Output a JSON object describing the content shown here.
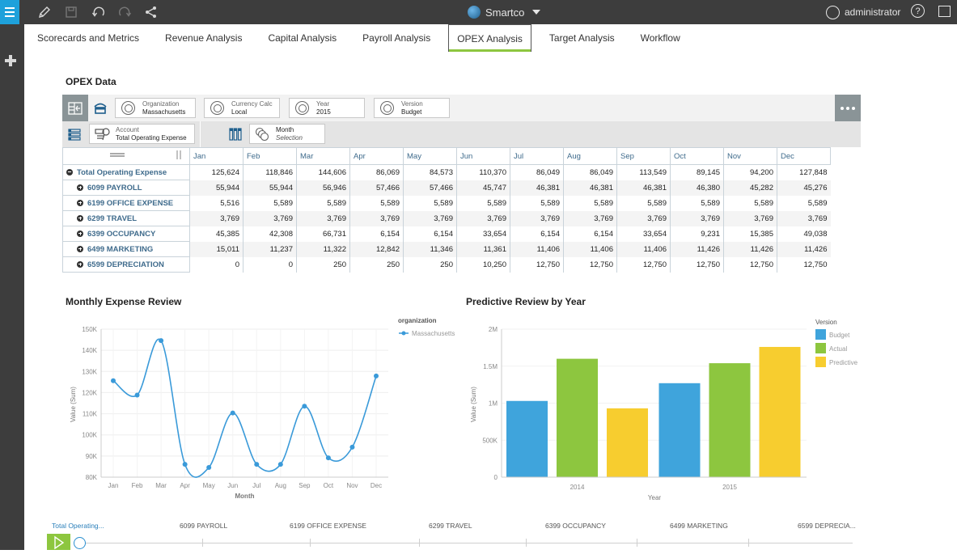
{
  "topbar": {
    "brand": "Smartco",
    "user": "administrator",
    "icons": [
      "menu-icon",
      "pencil-icon",
      "save-icon",
      "undo-icon",
      "redo-icon",
      "share-icon",
      "help-icon",
      "fullscreen-icon"
    ]
  },
  "sidebar": {
    "add_icon": "plus-icon"
  },
  "tabs": [
    {
      "label": "Scorecards and Metrics",
      "active": false
    },
    {
      "label": "Revenue Analysis",
      "active": false
    },
    {
      "label": "Capital Analysis",
      "active": false
    },
    {
      "label": "Payroll Analysis",
      "active": false
    },
    {
      "label": "OPEX Analysis",
      "active": true
    },
    {
      "label": "Target Analysis",
      "active": false
    },
    {
      "label": "Workflow",
      "active": false
    }
  ],
  "opex": {
    "title": "OPEX Data",
    "filters": [
      {
        "key": "Organization",
        "value": "Massachusetts"
      },
      {
        "key": "Currency Calc",
        "value": "Local"
      },
      {
        "key": "Year",
        "value": "2015"
      },
      {
        "key": "Version",
        "value": "Budget"
      }
    ],
    "rows_dimension": {
      "key": "Account",
      "value": "Total Operating Expense"
    },
    "columns_dimension": {
      "key": "Month",
      "value": "Selection"
    },
    "months": [
      "Jan",
      "Feb",
      "Mar",
      "Apr",
      "May",
      "Jun",
      "Jul",
      "Aug",
      "Sep",
      "Oct",
      "Nov",
      "Dec"
    ],
    "rows": [
      {
        "label": "Total Operating Expense",
        "expanded": true,
        "values": [
          "125,624",
          "118,846",
          "144,606",
          "86,069",
          "84,573",
          "110,370",
          "86,049",
          "86,049",
          "113,549",
          "89,145",
          "94,200",
          "127,848"
        ]
      },
      {
        "label": "6099 PAYROLL",
        "expanded": false,
        "values": [
          "55,944",
          "55,944",
          "56,946",
          "57,466",
          "57,466",
          "45,747",
          "46,381",
          "46,381",
          "46,381",
          "46,380",
          "45,282",
          "45,276"
        ]
      },
      {
        "label": "6199 OFFICE EXPENSE",
        "expanded": false,
        "values": [
          "5,516",
          "5,589",
          "5,589",
          "5,589",
          "5,589",
          "5,589",
          "5,589",
          "5,589",
          "5,589",
          "5,589",
          "5,589",
          "5,589"
        ]
      },
      {
        "label": "6299 TRAVEL",
        "expanded": false,
        "values": [
          "3,769",
          "3,769",
          "3,769",
          "3,769",
          "3,769",
          "3,769",
          "3,769",
          "3,769",
          "3,769",
          "3,769",
          "3,769",
          "3,769"
        ]
      },
      {
        "label": "6399 OCCUPANCY",
        "expanded": false,
        "values": [
          "45,385",
          "42,308",
          "66,731",
          "6,154",
          "6,154",
          "33,654",
          "6,154",
          "6,154",
          "33,654",
          "9,231",
          "15,385",
          "49,038"
        ]
      },
      {
        "label": "6499 MARKETING",
        "expanded": false,
        "values": [
          "15,011",
          "11,237",
          "11,322",
          "12,842",
          "11,346",
          "11,361",
          "11,406",
          "11,406",
          "11,406",
          "11,426",
          "11,426",
          "11,426"
        ]
      },
      {
        "label": "6599 DEPRECIATION",
        "expanded": false,
        "values": [
          "0",
          "0",
          "250",
          "250",
          "250",
          "10,250",
          "12,750",
          "12,750",
          "12,750",
          "12,750",
          "12,750",
          "12,750"
        ]
      }
    ]
  },
  "chart_data": [
    {
      "type": "line",
      "title": "Monthly Expense Review",
      "xlabel": "Month",
      "ylabel": "Value (Sum)",
      "categories": [
        "Jan",
        "Feb",
        "Mar",
        "Apr",
        "May",
        "Jun",
        "Jul",
        "Aug",
        "Sep",
        "Oct",
        "Nov",
        "Dec"
      ],
      "ylim": [
        80000,
        150000
      ],
      "yticks": [
        80000,
        90000,
        100000,
        110000,
        120000,
        130000,
        140000,
        150000
      ],
      "ytick_labels": [
        "80K",
        "90K",
        "100K",
        "110K",
        "120K",
        "130K",
        "140K",
        "150K"
      ],
      "legend_title": "organization",
      "legend_position": "top-right",
      "grid": true,
      "series": [
        {
          "name": "Massachusetts",
          "color": "#3a9ad9",
          "values": [
            125624,
            118846,
            144606,
            86069,
            84573,
            110370,
            86049,
            86049,
            113549,
            89145,
            94200,
            127848
          ]
        }
      ]
    },
    {
      "type": "bar",
      "title": "Predictive Review by Year",
      "xlabel": "Year",
      "ylabel": "Value (Sum)",
      "categories": [
        "2014",
        "2015"
      ],
      "ylim": [
        0,
        2000000
      ],
      "yticks": [
        0,
        500000,
        1000000,
        1500000,
        2000000
      ],
      "ytick_labels": [
        "0",
        "500K",
        "1M",
        "1.5M",
        "2M"
      ],
      "legend_title": "Version",
      "legend_position": "top-right",
      "grid": true,
      "series": [
        {
          "name": "Budget",
          "color": "#3fa4dc",
          "values": [
            1030000,
            1270000
          ]
        },
        {
          "name": "Actual",
          "color": "#8dc63f",
          "values": [
            1600000,
            1540000
          ]
        },
        {
          "name": "Predictive",
          "color": "#f7cd2f",
          "values": [
            930000,
            1760000
          ]
        }
      ]
    }
  ],
  "timeline": {
    "labels": [
      "Total Operating...",
      "6099 PAYROLL",
      "6199 OFFICE EXPENSE",
      "6299 TRAVEL",
      "6399 OCCUPANCY",
      "6499 MARKETING",
      "6599 DEPRECIA..."
    ]
  }
}
